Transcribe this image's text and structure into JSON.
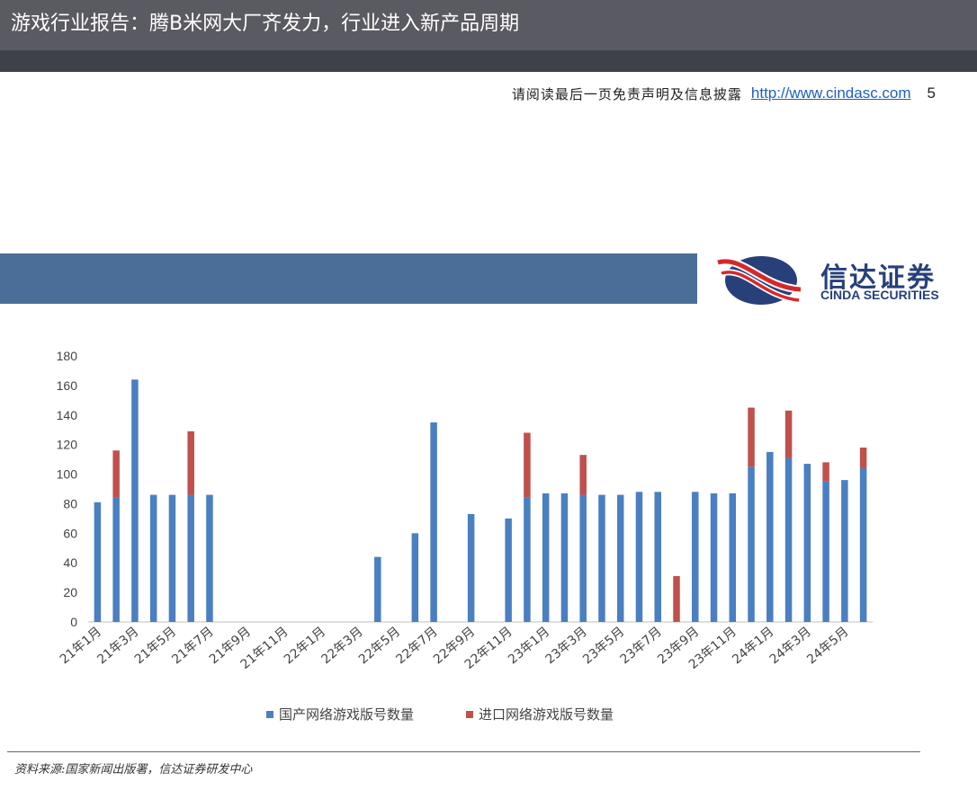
{
  "header": {
    "title": "游戏行业报告：腾B米网大厂齐发力，行业进入新产品周期",
    "disclaimer": "请阅读最后一页免责声明及信息披露",
    "link": "http://www.cindasc.com",
    "page_number": "5"
  },
  "logo": {
    "name_cn": "信达证券",
    "name_en": "CINDA SECURITIES",
    "icon": "cinda-logo-icon"
  },
  "colors": {
    "domestic": "#4a7fc1",
    "imported": "#c0504d",
    "banner": "#4a6e97",
    "logo": "#27407a"
  },
  "chart_data": {
    "type": "bar",
    "stacked": true,
    "categories": [
      "21年1月",
      "21年2月",
      "21年3月",
      "21年4月",
      "21年5月",
      "21年6月",
      "21年7月",
      "21年8月",
      "21年9月",
      "21年10月",
      "21年11月",
      "21年12月",
      "22年1月",
      "22年2月",
      "22年3月",
      "22年4月",
      "22年5月",
      "22年6月",
      "22年7月",
      "22年8月",
      "22年9月",
      "22年10月",
      "22年11月",
      "22年12月",
      "23年1月",
      "23年2月",
      "23年3月",
      "23年4月",
      "23年5月",
      "23年6月",
      "23年7月",
      "23年8月",
      "23年9月",
      "23年10月",
      "23年11月",
      "23年12月",
      "24年1月",
      "24年2月",
      "24年3月",
      "24年4月",
      "24年5月",
      "24年6月"
    ],
    "tick_labels": [
      "21年1月",
      "21年3月",
      "21年5月",
      "21年7月",
      "21年9月",
      "21年11月",
      "22年1月",
      "22年3月",
      "22年5月",
      "22年7月",
      "22年9月",
      "22年11月",
      "23年1月",
      "23年3月",
      "23年5月",
      "23年7月",
      "23年9月",
      "23年11月",
      "24年1月",
      "24年3月",
      "24年5月"
    ],
    "series": [
      {
        "name": "国产网络游戏版号数量",
        "values": [
          81,
          84,
          164,
          86,
          86,
          86,
          86,
          0,
          0,
          0,
          0,
          0,
          0,
          0,
          0,
          44,
          0,
          60,
          135,
          0,
          73,
          0,
          70,
          84,
          87,
          87,
          86,
          86,
          86,
          88,
          88,
          0,
          88,
          87,
          87,
          105,
          115,
          111,
          107,
          95,
          96,
          104
        ]
      },
      {
        "name": "进口网络游戏版号数量",
        "values": [
          0,
          32,
          0,
          0,
          0,
          43,
          0,
          0,
          0,
          0,
          0,
          0,
          0,
          0,
          0,
          0,
          0,
          0,
          0,
          0,
          0,
          0,
          0,
          44,
          0,
          0,
          27,
          0,
          0,
          0,
          0,
          31,
          0,
          0,
          0,
          40,
          0,
          32,
          0,
          13,
          0,
          14
        ]
      }
    ],
    "ylim": [
      0,
      180
    ],
    "yticks": [
      0,
      20,
      40,
      60,
      80,
      100,
      120,
      140,
      160,
      180
    ],
    "legend": "bottom",
    "grid": false,
    "source": "资料来源:国家新闻出版署，信达证券研发中心"
  }
}
